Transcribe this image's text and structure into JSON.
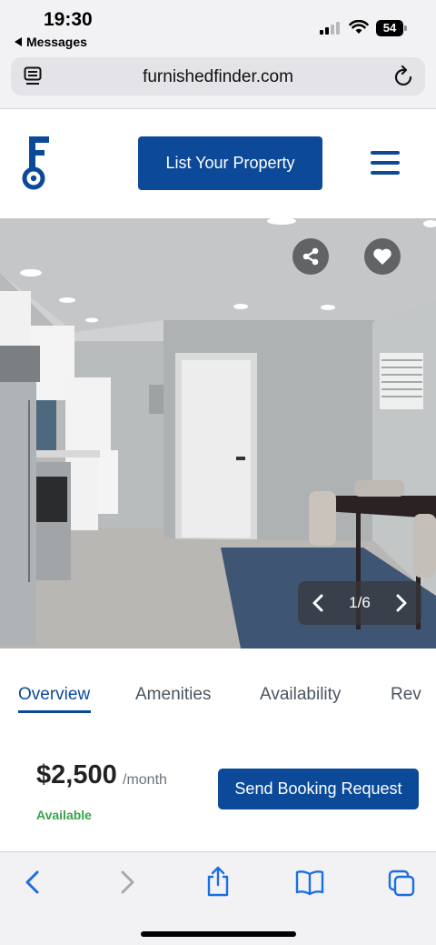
{
  "status_bar": {
    "time": "19:30",
    "back_app": "Messages",
    "battery": "54"
  },
  "browser": {
    "url": "furnishedfinder.com",
    "icons": [
      "reader-icon",
      "reload-icon"
    ]
  },
  "header": {
    "logo": "furnished-finder-key-logo",
    "list_property_label": "List Your Property",
    "menu_icon": "hamburger-icon"
  },
  "gallery": {
    "counter": "1/6",
    "icons": [
      "share-icon",
      "heart-icon",
      "chevron-left-icon",
      "chevron-right-icon"
    ]
  },
  "tabs": [
    {
      "label": "Overview",
      "active": true
    },
    {
      "label": "Amenities",
      "active": false
    },
    {
      "label": "Availability",
      "active": false
    },
    {
      "label": "Rev",
      "active": false
    }
  ],
  "listing": {
    "price": "$2,500",
    "period": "/month",
    "availability": "Available",
    "book_label": "Send Booking Request"
  },
  "toolbar": {
    "icons": [
      "back-icon",
      "forward-icon",
      "share-icon",
      "bookmarks-icon",
      "tabs-icon"
    ]
  },
  "colors": {
    "brand": "#0c4a99",
    "available": "#3aa24a",
    "chrome": "#f2f2f4"
  }
}
